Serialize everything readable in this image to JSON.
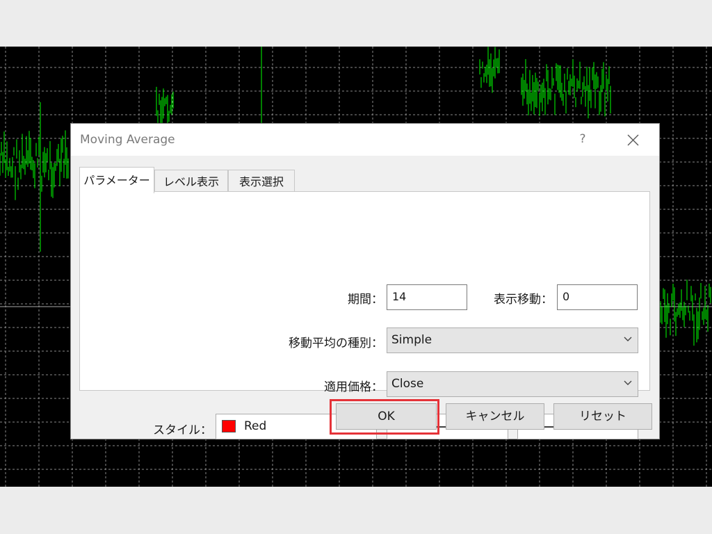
{
  "dialog": {
    "title": "Moving Average",
    "help": "?",
    "tabs": [
      {
        "label": "パラメーター",
        "active": true
      },
      {
        "label": "レベル表示",
        "active": false
      },
      {
        "label": "表示選択",
        "active": false
      }
    ]
  },
  "params": {
    "period_label": "期間：",
    "period_value": "14",
    "shift_label": "表示移動：",
    "shift_value": "0",
    "method_label": "移動平均の種別：",
    "method_value": "Simple",
    "apply_label": "適用価格：",
    "apply_value": "Close",
    "style_label": "スタイル：",
    "color_name": "Red",
    "color_hex": "#ff0000"
  },
  "buttons": {
    "ok": "OK",
    "cancel": "キャンセル",
    "reset": "リセット"
  },
  "colors": {
    "chart_bg": "#000000",
    "candle": "#00ff00",
    "grid": "#8a8a8a",
    "highlight": "#e53238"
  }
}
